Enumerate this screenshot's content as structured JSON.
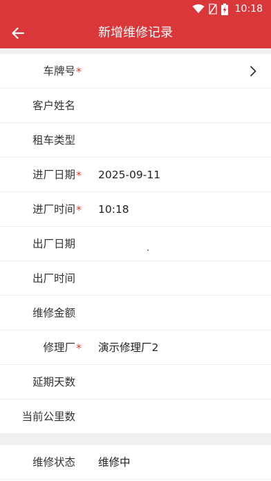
{
  "status_bar": {
    "time": "10:18",
    "icons": [
      "wifi-icon",
      "no-sim-icon",
      "battery-charging-icon"
    ]
  },
  "app_bar": {
    "title": "新增维修记录",
    "back_icon": "arrow-left-icon"
  },
  "form": {
    "rows": [
      {
        "label": "车牌号",
        "required": "*",
        "value": "",
        "has_chevron": true
      },
      {
        "label": "客户姓名",
        "required": "",
        "value": ""
      },
      {
        "label": "租车类型",
        "required": "",
        "value": ""
      },
      {
        "label": "进厂日期",
        "required": "*",
        "value": "2025-09-11"
      },
      {
        "label": "进厂时间",
        "required": "*",
        "value": "10:18"
      },
      {
        "label": "出厂日期",
        "required": "",
        "value": ""
      },
      {
        "label": "出厂时间",
        "required": "",
        "value": ""
      },
      {
        "label": "维修金额",
        "required": "",
        "value": ""
      },
      {
        "label": "修理厂",
        "required": "*",
        "value": "演示修理厂2"
      },
      {
        "label": "延期天数",
        "required": "",
        "value": ""
      },
      {
        "label": "当前公里数",
        "required": "",
        "value": ""
      }
    ],
    "status_row": {
      "label": "维修状态",
      "value": "维修中"
    }
  },
  "colors": {
    "primary": "#d9373a",
    "required": "#e53935",
    "section_background": "#f0f0f0"
  }
}
